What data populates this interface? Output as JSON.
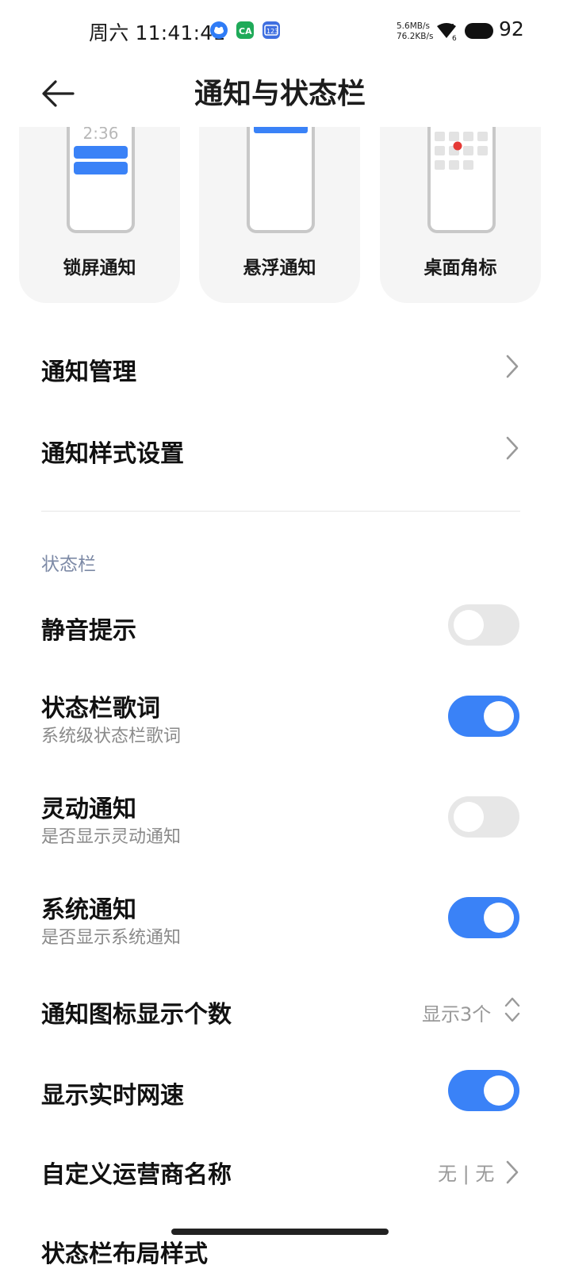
{
  "status_bar": {
    "time": "周六 11:41:41",
    "net_speed_up": "5.6MB/s",
    "net_speed_down": "76.2KB/s",
    "wifi_badge": "6",
    "battery": "92",
    "app_icons": [
      "baidu-netdisk-icon",
      "wechat-icon",
      "number-keyboard-icon"
    ]
  },
  "header": {
    "title": "通知与状态栏",
    "back_icon": "arrow-left-icon"
  },
  "cards": [
    {
      "label": "锁屏通知",
      "preview_time": "2:36"
    },
    {
      "label": "悬浮通知"
    },
    {
      "label": "桌面角标"
    }
  ],
  "menu": {
    "notification_management": "通知管理",
    "notification_style": "通知样式设置"
  },
  "status_section": {
    "label": "状态栏",
    "items": [
      {
        "title": "静音提示",
        "enabled": false
      },
      {
        "title": "状态栏歌词",
        "subtitle": "系统级状态栏歌词",
        "enabled": true
      },
      {
        "title": "灵动通知",
        "subtitle": "是否显示灵动通知",
        "enabled": false
      },
      {
        "title": "系统通知",
        "subtitle": "是否显示系统通知",
        "enabled": true
      }
    ],
    "icon_count": {
      "title": "通知图标显示个数",
      "value": "显示3个"
    },
    "show_speed": {
      "title": "显示实时网速",
      "enabled": true
    },
    "carrier": {
      "title": "自定义运营商名称",
      "value": "无 | 无"
    },
    "partial_next": "状态栏布局样式"
  },
  "colors": {
    "accent": "#3a82f7",
    "toggle_off": "#e7e7e7",
    "section_label": "#7d8aa6",
    "badge_red": "#e53935"
  }
}
